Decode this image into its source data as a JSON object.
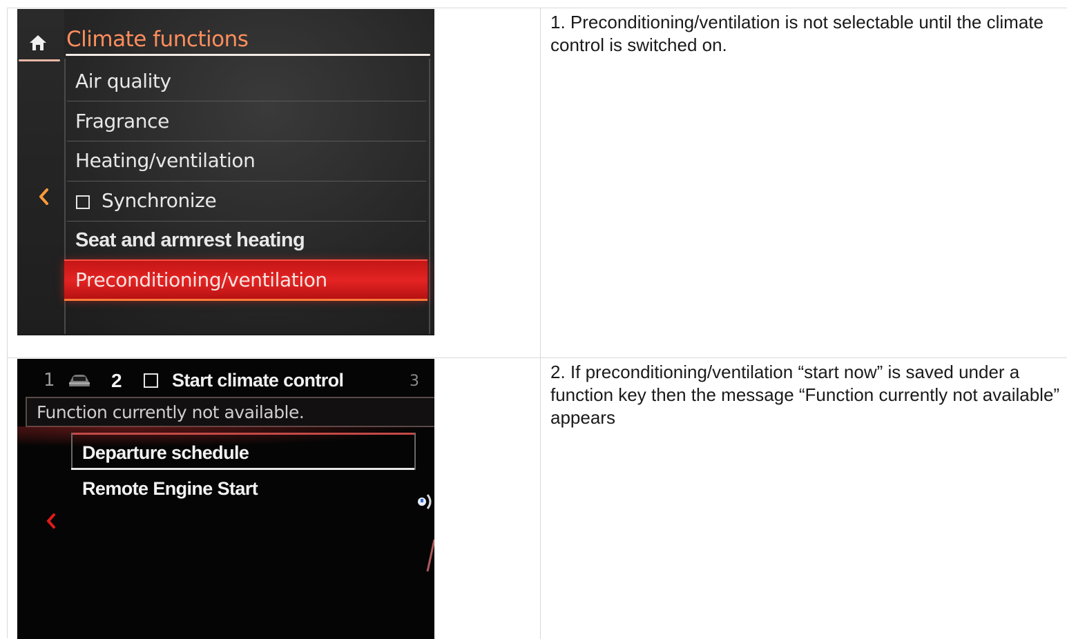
{
  "row1": {
    "screen": {
      "title": "Climate functions",
      "items": [
        "Air quality",
        "Fragrance",
        "Heating/ventilation",
        "Synchronize",
        "Seat and armrest heating",
        "Preconditioning/ventilation"
      ],
      "highlighted_item": "Preconditioning/ventilation",
      "accent_color": "#ff8e5c",
      "highlight_color": "#e42323",
      "icons": [
        "home-icon",
        "checkbox-icon",
        "back-chevron-icon"
      ]
    },
    "description": "1. Preconditioning/ventilation is not selectable until the climate control is switched on."
  },
  "row2": {
    "screen": {
      "tabs": {
        "tab1": "1",
        "tab2": "2",
        "tab3": "3"
      },
      "function_label": "Start climate control",
      "toast": "Function currently not available.",
      "items": [
        "Departure schedule",
        "Remote Engine Start"
      ],
      "icons": [
        "car-icon",
        "checkbox-icon",
        "back-chevron-icon",
        "scroll-indicator-icon"
      ]
    },
    "description": "2. If preconditioning/ventilation “start now” is saved under a function key then the message “Function currently not available” appears"
  }
}
